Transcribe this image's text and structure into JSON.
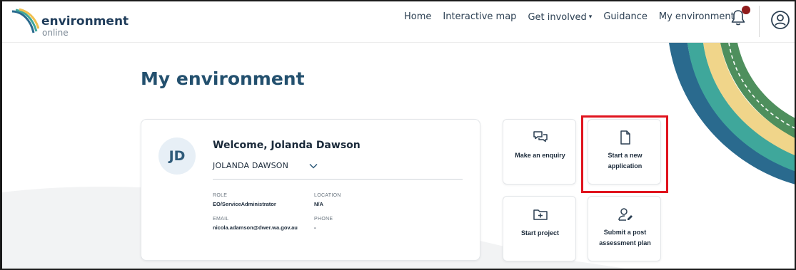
{
  "header": {
    "logo_main": "environment",
    "logo_sub": "online",
    "nav": [
      {
        "label": "Home"
      },
      {
        "label": "Interactive map"
      },
      {
        "label": "Get involved"
      },
      {
        "label": "Guidance"
      },
      {
        "label": "My environment"
      }
    ],
    "notification_color": "#8f1c1c"
  },
  "page": {
    "title": "My environment"
  },
  "profile": {
    "initials": "JD",
    "welcome": "Welcome, Jolanda Dawson",
    "selected_name": "JOLANDA DAWSON",
    "role_label": "ROLE",
    "role_value": "EO/ServiceAdministrator",
    "location_label": "LOCATION",
    "location_value": "N/A",
    "email_label": "EMAIL",
    "email_value": "nicola.adamson@dwer.wa.gov.au",
    "phone_label": "PHONE",
    "phone_value": "-"
  },
  "tiles": [
    {
      "label_line1": "Make an enquiry",
      "label_line2": "",
      "icon": "chat-bubbles-icon"
    },
    {
      "label_line1": "Start a new",
      "label_line2": "application",
      "icon": "document-icon"
    },
    {
      "label_line1": "Start project",
      "label_line2": "",
      "icon": "folder-plus-icon"
    },
    {
      "label_line1": "Submit a post",
      "label_line2": "assessment plan",
      "icon": "user-edit-icon"
    }
  ],
  "colors": {
    "title": "#23506e",
    "highlight": "#e0141e",
    "ring_blue": "#2a6a8e",
    "ring_teal": "#3fa79b",
    "ring_yellow": "#f0d58a",
    "ring_green": "#4e8f5d"
  }
}
